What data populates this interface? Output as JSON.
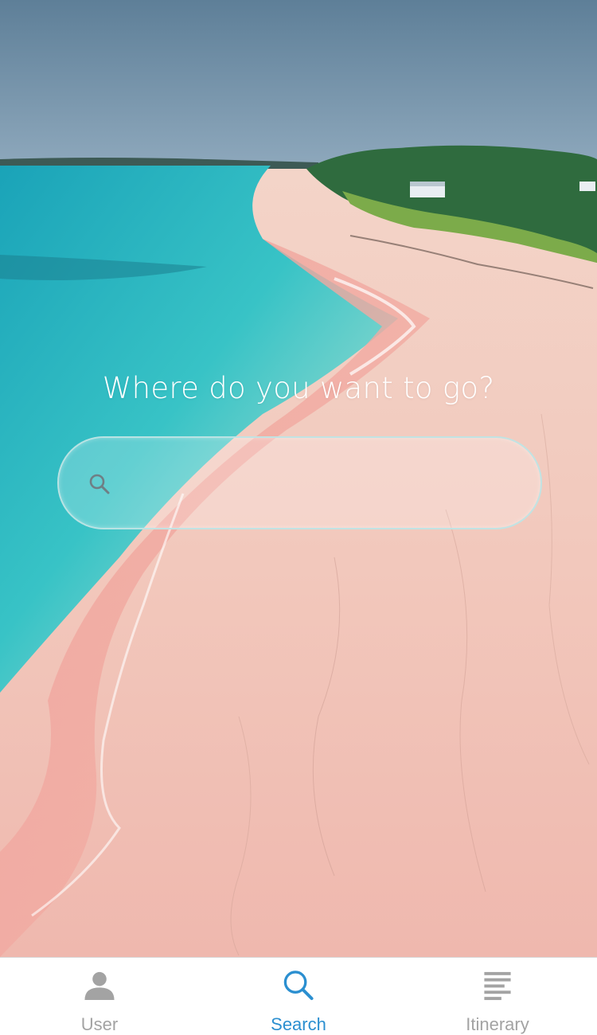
{
  "screen": {
    "headline": "Where do you want to go?"
  },
  "search": {
    "value": "",
    "placeholder": "",
    "icon": "search-icon"
  },
  "tabbar": {
    "active_color": "#2b8fd0",
    "inactive_color": "#a3a3a3",
    "tabs": [
      {
        "label": "User",
        "icon": "user-icon",
        "active": false
      },
      {
        "label": "Search",
        "icon": "search-icon",
        "active": true
      },
      {
        "label": "Itinerary",
        "icon": "list-icon",
        "active": false
      }
    ]
  }
}
